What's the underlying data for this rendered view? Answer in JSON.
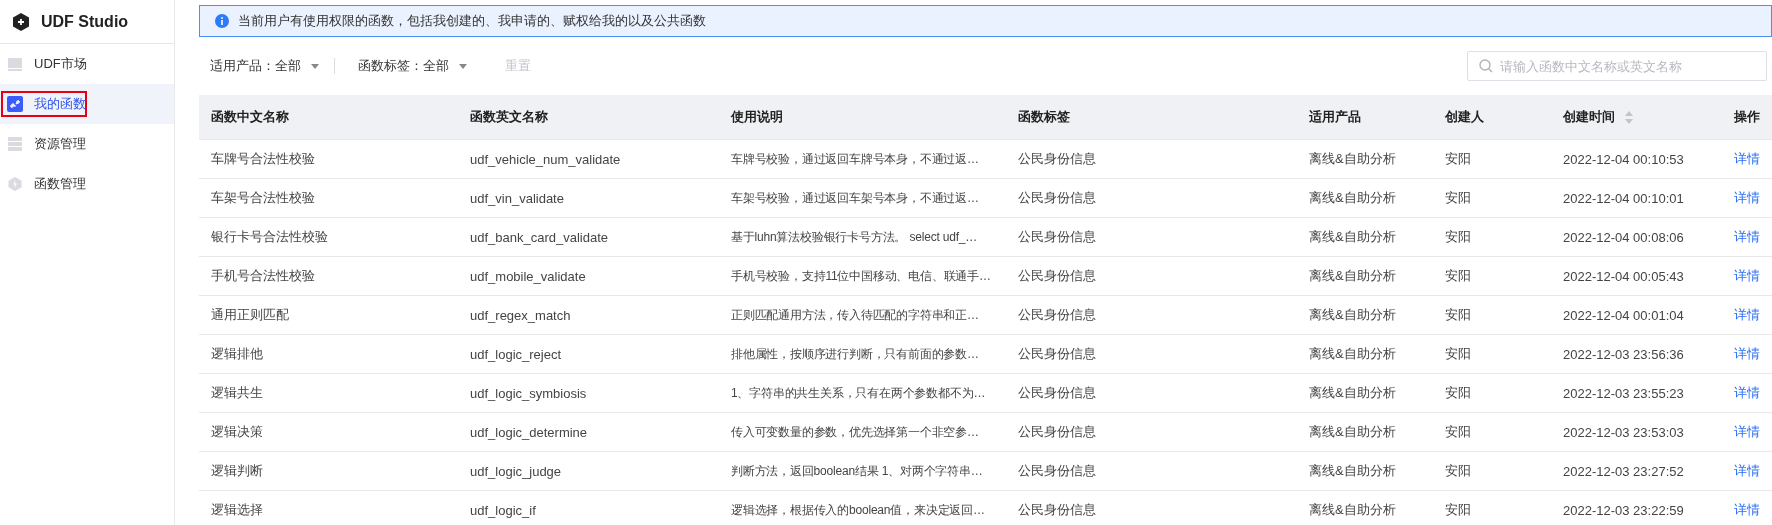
{
  "app": {
    "title": "UDF Studio"
  },
  "sidebar": {
    "items": [
      {
        "label": "UDF市场",
        "selected": false
      },
      {
        "label": "我的函数",
        "selected": true
      },
      {
        "label": "资源管理",
        "selected": false
      },
      {
        "label": "函数管理",
        "selected": false
      }
    ]
  },
  "notice": "当前用户有使用权限的函数，包括我创建的、我申请的、赋权给我的以及公共函数",
  "filters": [
    {
      "label": "适用产品：",
      "value": "全部"
    },
    {
      "label": "函数标签：",
      "value": "全部"
    }
  ],
  "reset_button": {
    "label": "重置",
    "disabled": true
  },
  "search": {
    "placeholder": "请输入函数中文名称或英文名称"
  },
  "table": {
    "columns": [
      {
        "label": "函数中文名称",
        "kind": "text",
        "sortable": false
      },
      {
        "label": "函数英文名称",
        "kind": "text",
        "sortable": false
      },
      {
        "label": "使用说明",
        "kind": "text",
        "sortable": false
      },
      {
        "label": "函数标签",
        "kind": "text",
        "sortable": false
      },
      {
        "label": "适用产品",
        "kind": "text",
        "sortable": false
      },
      {
        "label": "创建人",
        "kind": "text",
        "sortable": false
      },
      {
        "label": "创建时间",
        "kind": "text",
        "sortable": true
      },
      {
        "label": "操作",
        "kind": "link",
        "sortable": false
      }
    ],
    "rows": [
      [
        "车牌号合法性校验",
        "udf_vehicle_num_validate",
        "车牌号校验，通过返回车牌号本身，不通过返…",
        "公民身份信息",
        "离线&自助分析",
        "安阳",
        "2022-12-04 00:10:53",
        "详情"
      ],
      [
        "车架号合法性校验",
        "udf_vin_validate",
        "车架号校验，通过返回车架号本身，不通过返…",
        "公民身份信息",
        "离线&自助分析",
        "安阳",
        "2022-12-04 00:10:01",
        "详情"
      ],
      [
        "银行卡号合法性校验",
        "udf_bank_card_validate",
        "基于luhn算法校验银行卡号方法。 select udf_…",
        "公民身份信息",
        "离线&自助分析",
        "安阳",
        "2022-12-04 00:08:06",
        "详情"
      ],
      [
        "手机号合法性校验",
        "udf_mobile_validate",
        "手机号校验，支持11位中国移动、电信、联通手…",
        "公民身份信息",
        "离线&自助分析",
        "安阳",
        "2022-12-04 00:05:43",
        "详情"
      ],
      [
        "通用正则匹配",
        "udf_regex_match",
        "正则匹配通用方法，传入待匹配的字符串和正…",
        "公民身份信息",
        "离线&自助分析",
        "安阳",
        "2022-12-04 00:01:04",
        "详情"
      ],
      [
        "逻辑排他",
        "udf_logic_reject",
        "排他属性，按顺序进行判断，只有前面的参数…",
        "公民身份信息",
        "离线&自助分析",
        "安阳",
        "2022-12-03 23:56:36",
        "详情"
      ],
      [
        "逻辑共生",
        "udf_logic_symbiosis",
        "1、字符串的共生关系，只有在两个参数都不为…",
        "公民身份信息",
        "离线&自助分析",
        "安阳",
        "2022-12-03 23:55:23",
        "详情"
      ],
      [
        "逻辑决策",
        "udf_logic_determine",
        "传入可变数量的参数，优先选择第一个非空参…",
        "公民身份信息",
        "离线&自助分析",
        "安阳",
        "2022-12-03 23:53:03",
        "详情"
      ],
      [
        "逻辑判断",
        "udf_logic_judge",
        "判断方法，返回boolean结果 1、对两个字符串…",
        "公民身份信息",
        "离线&自助分析",
        "安阳",
        "2022-12-03 23:27:52",
        "详情"
      ],
      [
        "逻辑选择",
        "udf_logic_if",
        "逻辑选择，根据传入的boolean值，来决定返回…",
        "公民身份信息",
        "离线&自助分析",
        "安阳",
        "2022-12-03 23:22:59",
        "详情"
      ]
    ]
  }
}
